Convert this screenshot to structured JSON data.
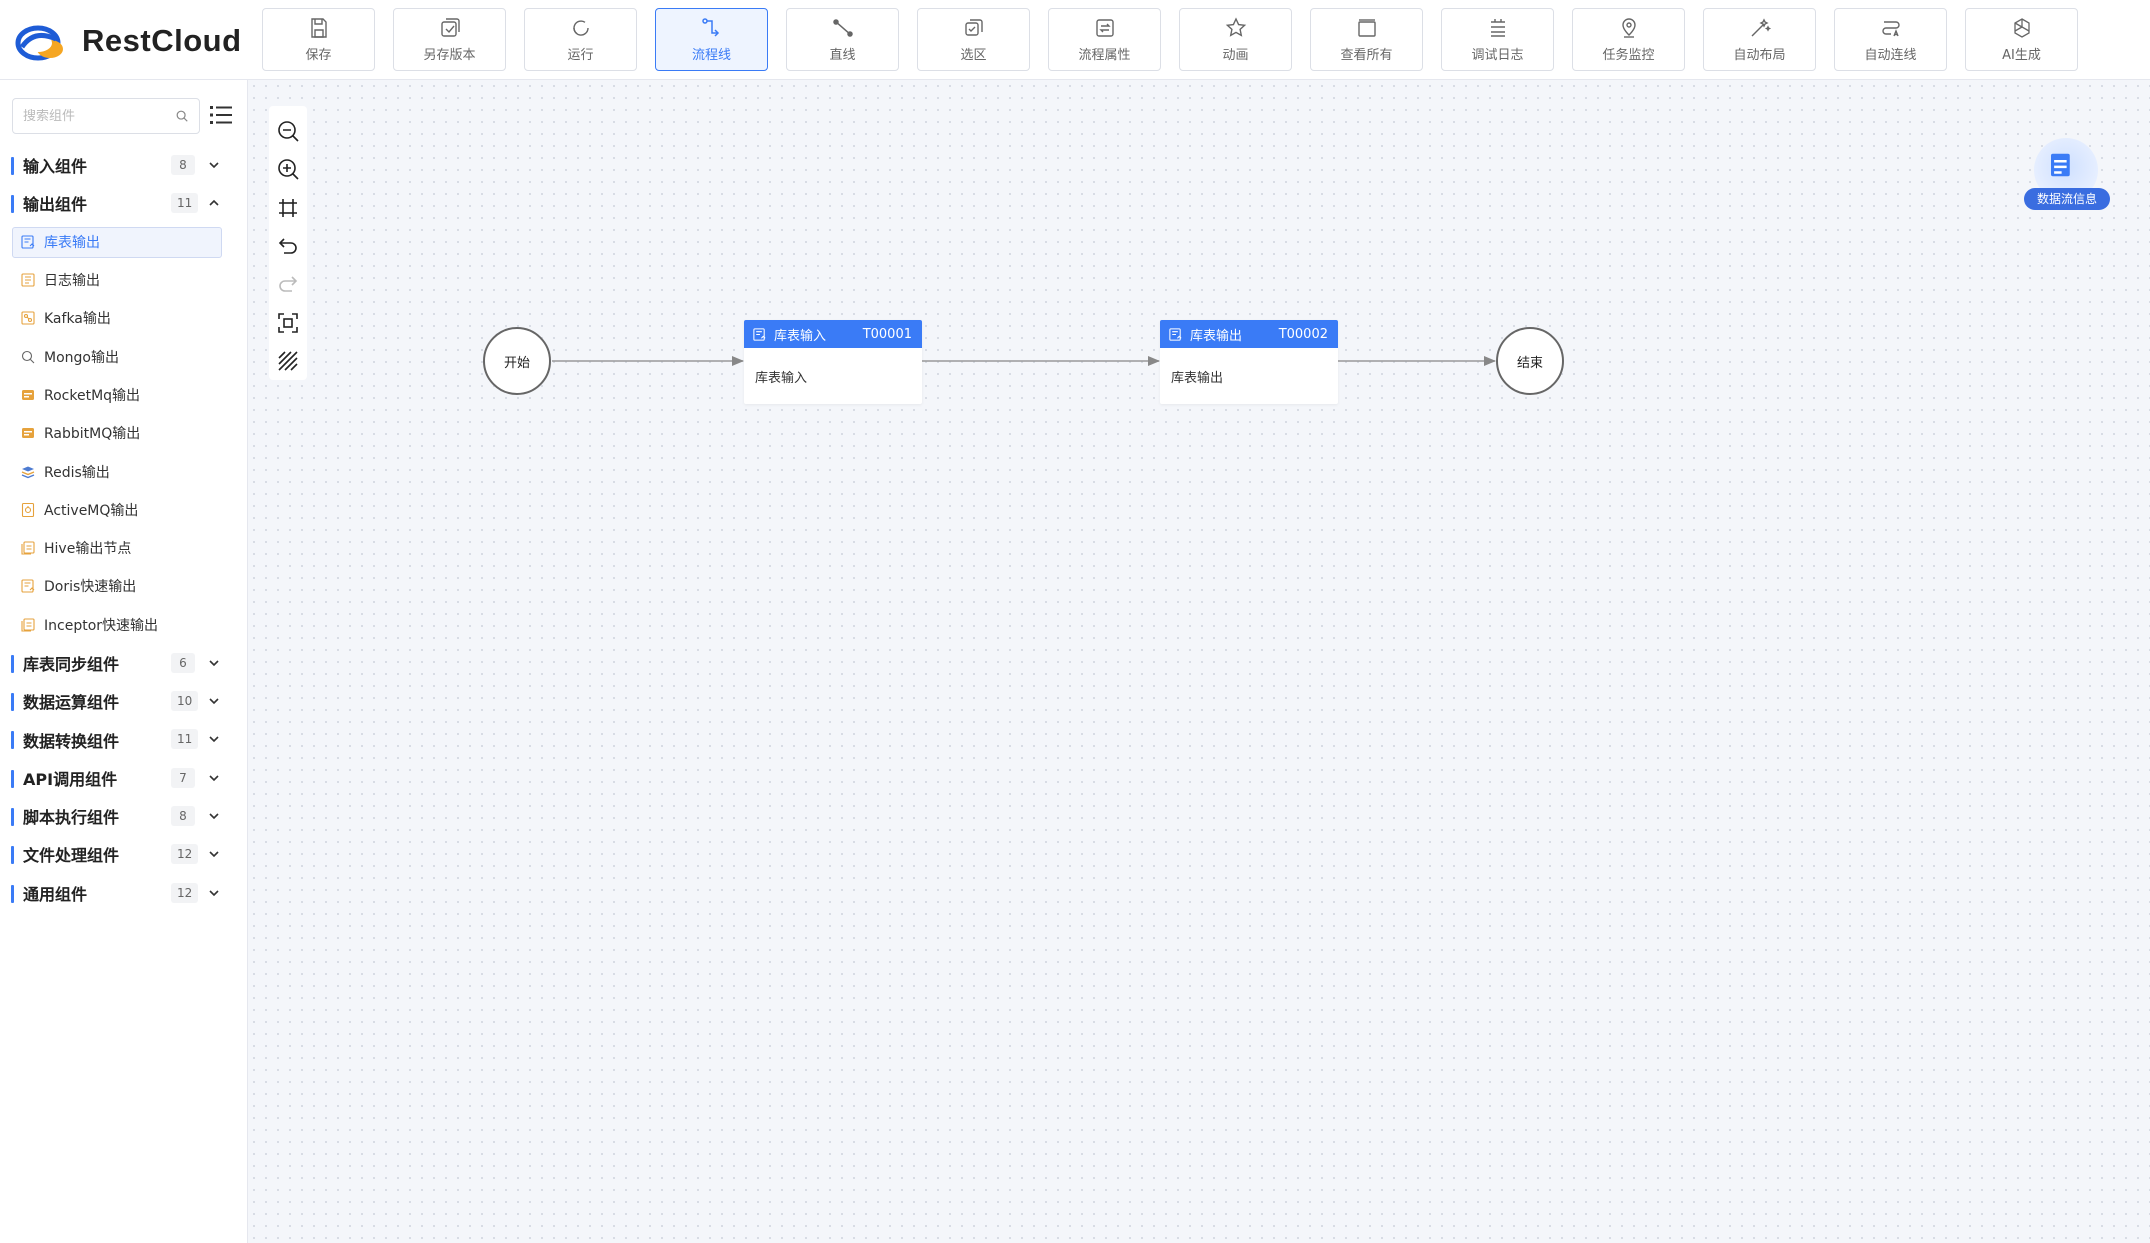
{
  "app": {
    "brand": "RestCloud"
  },
  "toolbar": {
    "items": [
      {
        "label": "保存",
        "icon": "save-icon"
      },
      {
        "label": "另存版本",
        "icon": "save-version-icon"
      },
      {
        "label": "运行",
        "icon": "run-icon"
      },
      {
        "label": "流程线",
        "icon": "flow-line-icon",
        "active": true
      },
      {
        "label": "直线",
        "icon": "straight-line-icon"
      },
      {
        "label": "选区",
        "icon": "select-area-icon"
      },
      {
        "label": "流程属性",
        "icon": "flow-properties-icon"
      },
      {
        "label": "动画",
        "icon": "animation-icon"
      },
      {
        "label": "查看所有",
        "icon": "view-all-icon"
      },
      {
        "label": "调试日志",
        "icon": "debug-log-icon"
      },
      {
        "label": "任务监控",
        "icon": "task-monitor-icon"
      },
      {
        "label": "自动布局",
        "icon": "auto-layout-icon"
      },
      {
        "label": "自动连线",
        "icon": "auto-connect-icon"
      },
      {
        "label": "AI生成",
        "icon": "ai-generate-icon"
      }
    ]
  },
  "sidebar": {
    "search_placeholder": "搜索组件",
    "groups": [
      {
        "title": "输入组件",
        "count": "8",
        "expanded": false
      },
      {
        "title": "输出组件",
        "count": "11",
        "expanded": true,
        "items": [
          {
            "label": "库表输出",
            "selected": true
          },
          {
            "label": "日志输出"
          },
          {
            "label": "Kafka输出"
          },
          {
            "label": "Mongo输出"
          },
          {
            "label": "RocketMq输出"
          },
          {
            "label": "RabbitMQ输出"
          },
          {
            "label": "Redis输出"
          },
          {
            "label": "ActiveMQ输出"
          },
          {
            "label": "Hive输出节点"
          },
          {
            "label": "Doris快速输出"
          },
          {
            "label": "Inceptor快速输出"
          }
        ]
      },
      {
        "title": "库表同步组件",
        "count": "6",
        "expanded": false
      },
      {
        "title": "数据运算组件",
        "count": "10",
        "expanded": false
      },
      {
        "title": "数据转换组件",
        "count": "11",
        "expanded": false
      },
      {
        "title": "API调用组件",
        "count": "7",
        "expanded": false
      },
      {
        "title": "脚本执行组件",
        "count": "8",
        "expanded": false
      },
      {
        "title": "文件处理组件",
        "count": "12",
        "expanded": false
      },
      {
        "title": "通用组件",
        "count": "12",
        "expanded": false
      }
    ]
  },
  "canvas": {
    "start_label": "开始",
    "end_label": "结束",
    "nodes": [
      {
        "title": "库表输入",
        "id": "T00001",
        "body": "库表输入"
      },
      {
        "title": "库表输出",
        "id": "T00002",
        "body": "库表输出"
      }
    ],
    "info_label": "数据流信息"
  },
  "colors": {
    "accent": "#3a7bf6",
    "canvas_bg": "#f4f6fa",
    "node_header": "#3a7bf6"
  }
}
